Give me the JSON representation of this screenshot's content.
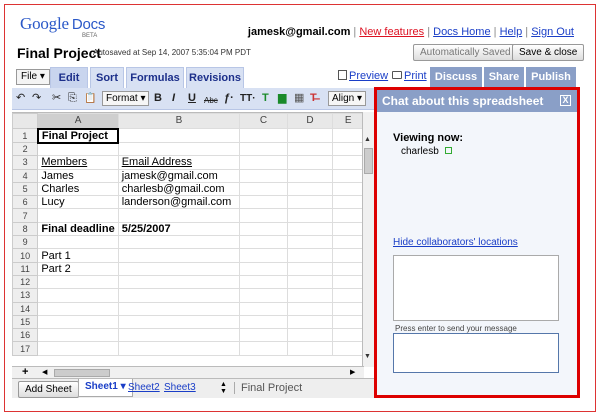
{
  "logo": {
    "word": "Google",
    "product": "Docs",
    "badge": "BETA"
  },
  "user": {
    "email": "jamesk@gmail.com",
    "new_features": "New features",
    "docs_home": "Docs Home",
    "help": "Help",
    "sign_out": "Sign Out",
    "sep": "|"
  },
  "doc": {
    "title": "Final Project",
    "autosave": "Autosaved at Sep 14, 2007 5:35:04 PM PDT"
  },
  "buttons": {
    "auto_saved": "Automatically Saved",
    "save_close": "Save & close"
  },
  "menu": {
    "file": "File ▾",
    "tabs": [
      "Edit",
      "Sort",
      "Formulas",
      "Revisions"
    ],
    "preview": "Preview",
    "print": "Print",
    "discuss": "Discuss",
    "share": "Share",
    "publish": "Publish"
  },
  "toolbar": {
    "undo": "↶",
    "redo": "↷",
    "cut": "✂",
    "copy": "⎘",
    "paste": "📋",
    "format": "Format ▾",
    "bold": "B",
    "italic": "I",
    "underline": "U",
    "strike": "Abc",
    "font": "ƒ·",
    "size": "TT·",
    "color": "T",
    "bg": "▆",
    "borders": "▦",
    "clear": "T̶",
    "align": "Align ▾"
  },
  "columns": [
    "A",
    "B",
    "C",
    "D",
    "E"
  ],
  "rows": [
    {
      "n": "1",
      "a": "Final Project",
      "b": "",
      "bold": true
    },
    {
      "n": "2",
      "a": "",
      "b": ""
    },
    {
      "n": "3",
      "a": "Members",
      "b": "Email Address",
      "underline": true
    },
    {
      "n": "4",
      "a": "James",
      "b": "jamesk@gmail.com"
    },
    {
      "n": "5",
      "a": "Charles",
      "b": "charlesb@gmail.com"
    },
    {
      "n": "6",
      "a": "Lucy",
      "b": "landerson@gmail.com"
    },
    {
      "n": "7",
      "a": "",
      "b": ""
    },
    {
      "n": "8",
      "a": "Final deadline",
      "b": "5/25/2007",
      "bold": true
    },
    {
      "n": "9",
      "a": "",
      "b": ""
    },
    {
      "n": "10",
      "a": "Part 1",
      "b": ""
    },
    {
      "n": "11",
      "a": "Part 2",
      "b": ""
    },
    {
      "n": "12",
      "a": "",
      "b": ""
    },
    {
      "n": "13",
      "a": "",
      "b": ""
    },
    {
      "n": "14",
      "a": "",
      "b": ""
    },
    {
      "n": "15",
      "a": "",
      "b": ""
    },
    {
      "n": "16",
      "a": "",
      "b": ""
    },
    {
      "n": "17",
      "a": "",
      "b": ""
    }
  ],
  "sheets": {
    "plus": "+",
    "add": "Add Sheet",
    "tabs": [
      "Sheet1 ▾",
      "Sheet2",
      "Sheet3"
    ],
    "current_name": "Final Project"
  },
  "chat": {
    "title": "Chat about this spreadsheet",
    "close": "X",
    "viewing_label": "Viewing now:",
    "viewer": "charlesb",
    "hide_link": "Hide collaborators' locations",
    "hint": "Press enter to send your message"
  },
  "colors": {
    "tab_blue": "#8a9fc7",
    "link": "#1a3ec7",
    "highlight": "#dd0000"
  }
}
